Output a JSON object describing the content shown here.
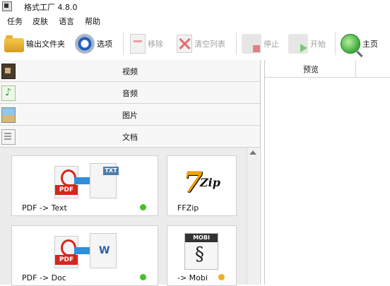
{
  "window": {
    "title": "格式工厂 4.8.0"
  },
  "menu": [
    "任务",
    "皮肤",
    "语言",
    "帮助"
  ],
  "toolbar": {
    "output_folder": "输出文件夹",
    "options": "选项",
    "remove": "移除",
    "clear_list": "清空列表",
    "stop": "停止",
    "start": "开始",
    "home": "主页"
  },
  "categories": [
    "视频",
    "音频",
    "图片",
    "文档"
  ],
  "tiles": [
    {
      "label": "PDF -> Text",
      "badge": "TXT",
      "status": "green"
    },
    {
      "label": "FFZip",
      "art": "Zip"
    },
    {
      "label": "PDF -> Doc",
      "badge": "W",
      "status": "green"
    },
    {
      "label": "-> Mobi",
      "badge": "MOBI",
      "status": "orange"
    }
  ],
  "preview": {
    "header": "预览"
  },
  "colors": {
    "accent": "#2f8fd8",
    "green": "#46c02a",
    "orange": "#f0b020",
    "pdf_red": "#d8251c"
  }
}
